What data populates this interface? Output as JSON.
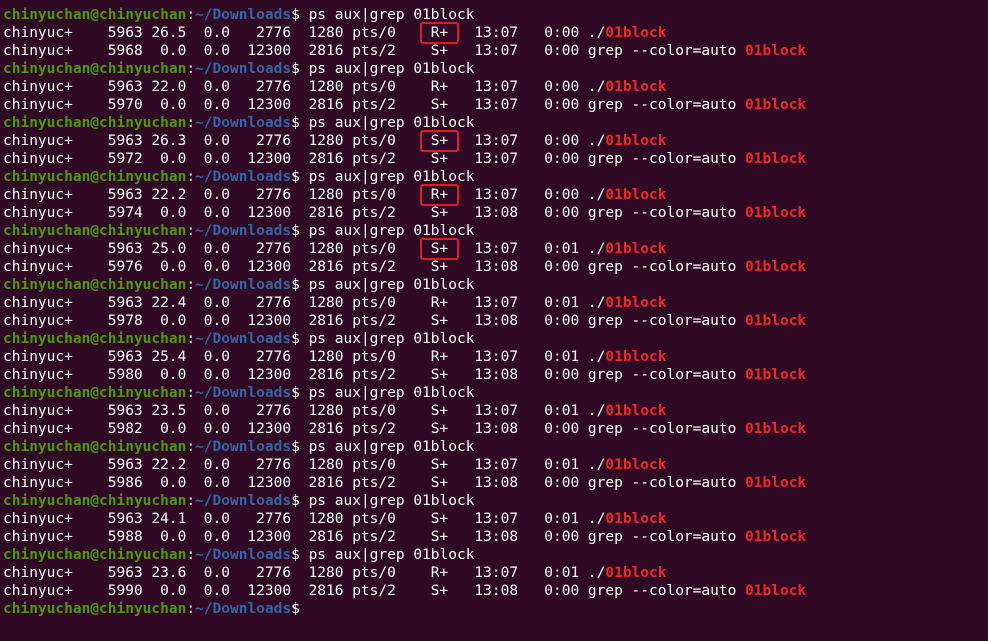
{
  "prompt": {
    "user_host": "chinyuchan@chinyuchan",
    "colon": ":",
    "path": "~/Downloads",
    "dollar": "$ "
  },
  "command": "ps aux|grep 01block",
  "match_text": "01block",
  "colors": {
    "background": "#300a24",
    "user": "#4e9a06",
    "path": "#3465a4",
    "match": "#ef2929",
    "highlight_box": "#e01b24"
  },
  "blocks": [
    {
      "proc": "chinyuc+    5963 26.5  0.0   2776  1280 pts/0    ",
      "proc_stat": "R+",
      "proc_tail": "   13:07   0:00 ./",
      "grep": "chinyuc+    5968  0.0  0.0  12300  2816 pts/2    ",
      "grep_stat": "S+",
      "grep_tail": "   13:07   0:00 grep --color=auto ",
      "highlighted": true
    },
    {
      "proc": "chinyuc+    5963 22.0  0.0   2776  1280 pts/0    ",
      "proc_stat": "R+",
      "proc_tail": "   13:07   0:00 ./",
      "grep": "chinyuc+    5970  0.0  0.0  12300  2816 pts/2    ",
      "grep_stat": "S+",
      "grep_tail": "   13:07   0:00 grep --color=auto ",
      "highlighted": false
    },
    {
      "proc": "chinyuc+    5963 26.3  0.0   2776  1280 pts/0    ",
      "proc_stat": "S+",
      "proc_tail": "   13:07   0:00 ./",
      "grep": "chinyuc+    5972  0.0  0.0  12300  2816 pts/2    ",
      "grep_stat": "S+",
      "grep_tail": "   13:07   0:00 grep --color=auto ",
      "highlighted": true
    },
    {
      "proc": "chinyuc+    5963 22.2  0.0   2776  1280 pts/0    ",
      "proc_stat": "R+",
      "proc_tail": "   13:07   0:00 ./",
      "grep": "chinyuc+    5974  0.0  0.0  12300  2816 pts/2    ",
      "grep_stat": "S+",
      "grep_tail": "   13:08   0:00 grep --color=auto ",
      "highlighted": true
    },
    {
      "proc": "chinyuc+    5963 25.0  0.0   2776  1280 pts/0    ",
      "proc_stat": "S+",
      "proc_tail": "   13:07   0:01 ./",
      "grep": "chinyuc+    5976  0.0  0.0  12300  2816 pts/2    ",
      "grep_stat": "S+",
      "grep_tail": "   13:08   0:00 grep --color=auto ",
      "highlighted": true
    },
    {
      "proc": "chinyuc+    5963 22.4  0.0   2776  1280 pts/0    ",
      "proc_stat": "R+",
      "proc_tail": "   13:07   0:01 ./",
      "grep": "chinyuc+    5978  0.0  0.0  12300  2816 pts/2    ",
      "grep_stat": "S+",
      "grep_tail": "   13:08   0:00 grep --color=auto ",
      "highlighted": false
    },
    {
      "proc": "chinyuc+    5963 25.4  0.0   2776  1280 pts/0    ",
      "proc_stat": "R+",
      "proc_tail": "   13:07   0:01 ./",
      "grep": "chinyuc+    5980  0.0  0.0  12300  2816 pts/2    ",
      "grep_stat": "S+",
      "grep_tail": "   13:08   0:00 grep --color=auto ",
      "highlighted": false
    },
    {
      "proc": "chinyuc+    5963 23.5  0.0   2776  1280 pts/0    ",
      "proc_stat": "S+",
      "proc_tail": "   13:07   0:01 ./",
      "grep": "chinyuc+    5982  0.0  0.0  12300  2816 pts/2    ",
      "grep_stat": "S+",
      "grep_tail": "   13:08   0:00 grep --color=auto ",
      "highlighted": false
    },
    {
      "proc": "chinyuc+    5963 22.2  0.0   2776  1280 pts/0    ",
      "proc_stat": "S+",
      "proc_tail": "   13:07   0:01 ./",
      "grep": "chinyuc+    5986  0.0  0.0  12300  2816 pts/2    ",
      "grep_stat": "S+",
      "grep_tail": "   13:08   0:00 grep --color=auto ",
      "highlighted": false
    },
    {
      "proc": "chinyuc+    5963 24.1  0.0   2776  1280 pts/0    ",
      "proc_stat": "S+",
      "proc_tail": "   13:07   0:01 ./",
      "grep": "chinyuc+    5988  0.0  0.0  12300  2816 pts/2    ",
      "grep_stat": "S+",
      "grep_tail": "   13:08   0:00 grep --color=auto ",
      "highlighted": false
    },
    {
      "proc": "chinyuc+    5963 23.6  0.0   2776  1280 pts/0    ",
      "proc_stat": "R+",
      "proc_tail": "   13:07   0:01 ./",
      "grep": "chinyuc+    5990  0.0  0.0  12300  2816 pts/2    ",
      "grep_stat": "S+",
      "grep_tail": "   13:08   0:00 grep --color=auto ",
      "highlighted": false
    }
  ]
}
